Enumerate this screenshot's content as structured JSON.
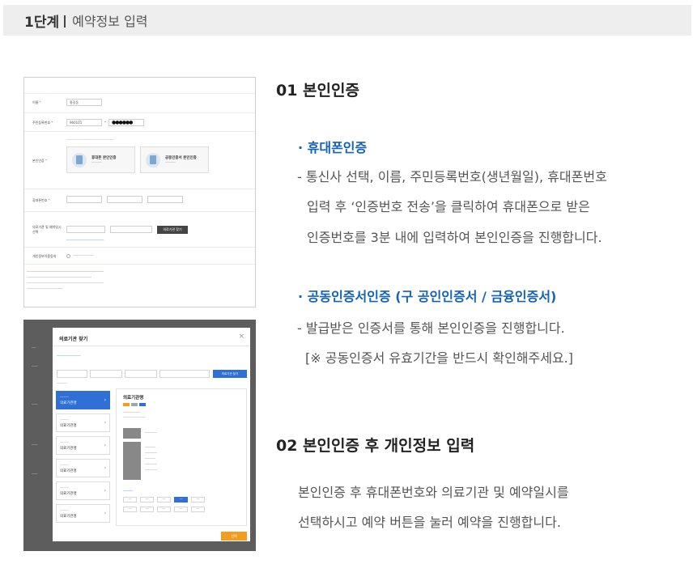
{
  "header": {
    "step": "1단계",
    "title": "예약정보 입력"
  },
  "shot1": {
    "name_label": "이름",
    "name_value": "홍길동",
    "rrn_label": "주민등록번호",
    "rrn_front": "960101",
    "rrn_dash": "-",
    "rrn_back": "●●●●●●",
    "auth_label": "본인인증",
    "auth_mobile": "휴대폰 본인인증",
    "auth_cert": "공동인증서 본인인증",
    "phone_label": "휴대폰번호",
    "org_label": "의료기관 및 예약일시 선택",
    "org_button": "의료기관 찾기",
    "privacy_label": "개인정보이용동의"
  },
  "shot2": {
    "modal_title": "의료기관 찾기",
    "close": "×",
    "search_button": "의료기관 찾기",
    "detail_name": "의료기관명",
    "list_label": "의료기관명",
    "select_button": "선택"
  },
  "sections": {
    "s1_title": "01 본인인증",
    "s1_b1_title": "· 휴대폰인증",
    "s1_b1_l1": "- 통신사 선택, 이름, 주민등록번호(생년월일), 휴대폰번호",
    "s1_b1_l2": "입력 후 ‘인증번호 전송’을 클릭하여 휴대폰으로 받은",
    "s1_b1_l3": "인증번호를 3분 내에 입력하여 본인인증을 진행합니다.",
    "s1_b2_title": "· 공동인증서인증 (구 공인인증서 / 금융인증서)",
    "s1_b2_l1": "- 발급받은 인증서를 통해 본인인증을 진행합니다.",
    "s1_b2_l2": "[※ 공동인증서 유효기간을 반드시 확인해주세요.]",
    "s2_title": "02 본인인증 후 개인정보 입력",
    "s2_l1": "본인인증 후 휴대폰번호와 의료기관 및 예약일시를",
    "s2_l2": "선택하시고 예약 버튼을 눌러 예약을 진행합니다."
  },
  "colors": {
    "accent_blue": "#1463b6",
    "orange": "#f39c1f",
    "bar_grey": "#eeeeee"
  }
}
